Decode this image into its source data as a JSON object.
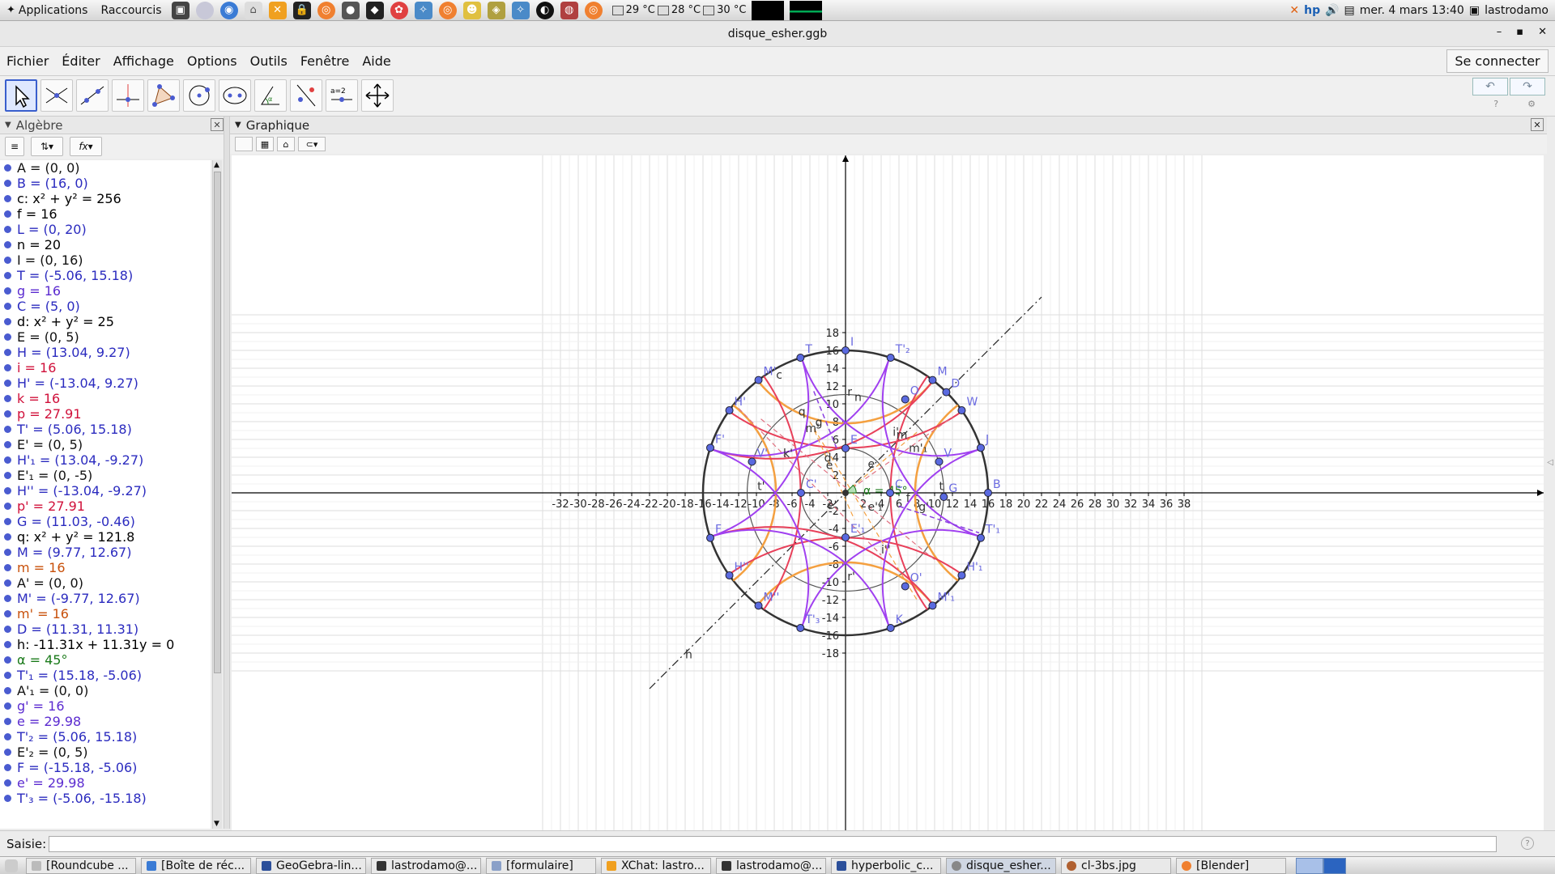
{
  "system_panel": {
    "applications": "Applications",
    "shortcuts": "Raccourcis",
    "temps": [
      "29 °C",
      "28 °C",
      "30 °C"
    ],
    "clock": "mer. 4 mars 13:40",
    "user": "lastrodamo"
  },
  "window": {
    "title": "disque_esher.ggb"
  },
  "menu": {
    "items": [
      "Fichier",
      "Éditer",
      "Affichage",
      "Options",
      "Outils",
      "Fenêtre",
      "Aide"
    ],
    "connect": "Se connecter"
  },
  "toolbar": {
    "tools": [
      "move",
      "point",
      "line",
      "perpendicular",
      "polygon",
      "circle",
      "conic",
      "angle",
      "reflect",
      "slider",
      "move-view"
    ],
    "slider_label": "a=2"
  },
  "algebra": {
    "title": "Algèbre",
    "rows": [
      {
        "text": "A = (0, 0)",
        "color": "#111111"
      },
      {
        "text": "B = (16, 0)",
        "color": "#2b2bbf"
      },
      {
        "text": "c: x² + y² = 256",
        "color": "#000000"
      },
      {
        "text": "f = 16",
        "color": "#000000"
      },
      {
        "text": "L = (0, 20)",
        "color": "#2b2bbf"
      },
      {
        "text": "n = 20",
        "color": "#000000"
      },
      {
        "text": "I = (0, 16)",
        "color": "#111111"
      },
      {
        "text": "T = (-5.06, 15.18)",
        "color": "#2b2bbf"
      },
      {
        "text": "g = 16",
        "color": "#5b2bd0"
      },
      {
        "text": "C = (5, 0)",
        "color": "#2b2bbf"
      },
      {
        "text": "d: x² + y² = 25",
        "color": "#000000"
      },
      {
        "text": "E = (0, 5)",
        "color": "#111111"
      },
      {
        "text": "H = (13.04, 9.27)",
        "color": "#2b2bbf"
      },
      {
        "text": "i = 16",
        "color": "#d0103a"
      },
      {
        "text": "H' = (-13.04, 9.27)",
        "color": "#2b2bbf"
      },
      {
        "text": "k = 16",
        "color": "#d0103a"
      },
      {
        "text": "p = 27.91",
        "color": "#d0103a"
      },
      {
        "text": "T' = (5.06, 15.18)",
        "color": "#2b2bbf"
      },
      {
        "text": "E' = (0, 5)",
        "color": "#111111"
      },
      {
        "text": "H'₁ = (13.04, -9.27)",
        "color": "#2b2bbf"
      },
      {
        "text": "E'₁ = (0, -5)",
        "color": "#111111"
      },
      {
        "text": "H'' = (-13.04, -9.27)",
        "color": "#2b2bbf"
      },
      {
        "text": "p' = 27.91",
        "color": "#d0103a"
      },
      {
        "text": "G = (11.03, -0.46)",
        "color": "#2b2bbf"
      },
      {
        "text": "q: x² + y² = 121.8",
        "color": "#000000"
      },
      {
        "text": "M = (9.77, 12.67)",
        "color": "#2b2bbf"
      },
      {
        "text": "m = 16",
        "color": "#c8500a"
      },
      {
        "text": "A' = (0, 0)",
        "color": "#111111"
      },
      {
        "text": "M' = (-9.77, 12.67)",
        "color": "#2b2bbf"
      },
      {
        "text": "m' = 16",
        "color": "#c8500a"
      },
      {
        "text": "D = (11.31, 11.31)",
        "color": "#2b2bbf"
      },
      {
        "text": "h: -11.31x + 11.31y = 0",
        "color": "#000000"
      },
      {
        "text": "α = 45°",
        "color": "#1a7a1a"
      },
      {
        "text": "T'₁ = (15.18, -5.06)",
        "color": "#2b2bbf"
      },
      {
        "text": "A'₁ = (0, 0)",
        "color": "#111111"
      },
      {
        "text": "g' = 16",
        "color": "#5b2bd0"
      },
      {
        "text": "e = 29.98",
        "color": "#5b2bd0"
      },
      {
        "text": "T'₂ = (5.06, 15.18)",
        "color": "#2b2bbf"
      },
      {
        "text": "E'₂ = (0, 5)",
        "color": "#111111"
      },
      {
        "text": "F = (-15.18, -5.06)",
        "color": "#2b2bbf"
      },
      {
        "text": "e' = 29.98",
        "color": "#5b2bd0"
      },
      {
        "text": "T'₃ = (-5.06, -15.18)",
        "color": "#2b2bbf"
      }
    ]
  },
  "graphics": {
    "title": "Graphique",
    "x_ticks": [
      -32,
      -30,
      -28,
      -26,
      -24,
      -22,
      -20,
      -18,
      -16,
      -14,
      -12,
      -10,
      -8,
      -6,
      -4,
      -2,
      2,
      4,
      6,
      8,
      10,
      12,
      14,
      16,
      18,
      20,
      22,
      24,
      26,
      28,
      30,
      32,
      34,
      36,
      38
    ],
    "y_ticks": [
      -18,
      -16,
      -14,
      -12,
      -10,
      -8,
      -6,
      -4,
      -2,
      2,
      4,
      6,
      8,
      10,
      12,
      14,
      16,
      18
    ],
    "circles": [
      {
        "name": "c",
        "r": 16,
        "color": "#333333"
      },
      {
        "name": "q",
        "r": 11.04,
        "color": "#555555"
      },
      {
        "name": "d",
        "r": 5,
        "color": "#555555"
      }
    ],
    "angle_label": "α = 45°",
    "points": [
      {
        "label": "B",
        "x": 16,
        "y": 0
      },
      {
        "label": "T",
        "x": -5.06,
        "y": 15.18
      },
      {
        "label": "T'₂",
        "x": 5.06,
        "y": 15.18
      },
      {
        "label": "H'",
        "x": -13.04,
        "y": 9.27
      },
      {
        "label": "W",
        "x": 13.04,
        "y": 9.27
      },
      {
        "label": "M",
        "x": 9.77,
        "y": 12.67
      },
      {
        "label": "M'",
        "x": -9.77,
        "y": 12.67
      },
      {
        "label": "D",
        "x": 11.31,
        "y": 11.31
      },
      {
        "label": "F",
        "x": -15.18,
        "y": -5.06
      },
      {
        "label": "F'",
        "x": -15.18,
        "y": 5.06
      },
      {
        "label": "J",
        "x": 15.18,
        "y": 5.06
      },
      {
        "label": "T'₁",
        "x": 15.18,
        "y": -5.06
      },
      {
        "label": "H''",
        "x": -13.04,
        "y": -9.27
      },
      {
        "label": "H'₁",
        "x": 13.04,
        "y": -9.27
      },
      {
        "label": "M''",
        "x": -9.77,
        "y": -12.67
      },
      {
        "label": "M'₁",
        "x": 9.77,
        "y": -12.67
      },
      {
        "label": "T'₃",
        "x": -5.06,
        "y": -15.18
      },
      {
        "label": "K",
        "x": 5.06,
        "y": -15.18
      },
      {
        "label": "G",
        "x": 11.03,
        "y": -0.46
      },
      {
        "label": "C",
        "x": 5,
        "y": 0
      },
      {
        "label": "C'",
        "x": -5,
        "y": 0
      },
      {
        "label": "E",
        "x": 0,
        "y": 5
      },
      {
        "label": "E'₁",
        "x": 0,
        "y": -5
      },
      {
        "label": "O",
        "x": 6.7,
        "y": 10.5
      },
      {
        "label": "O'",
        "x": 6.7,
        "y": -10.5
      },
      {
        "label": "V",
        "x": 10.5,
        "y": 3.5
      },
      {
        "label": "V'",
        "x": -10.5,
        "y": 3.5
      },
      {
        "label": "I",
        "x": 0,
        "y": 16
      }
    ],
    "curve_labels": [
      {
        "t": "c",
        "x": -7.8,
        "y": 12.8
      },
      {
        "t": "q",
        "x": -5.3,
        "y": 8.7
      },
      {
        "t": "d",
        "x": -2.4,
        "y": 3.5
      },
      {
        "t": "n",
        "x": 1,
        "y": 10.3
      },
      {
        "t": "r",
        "x": 0.2,
        "y": 10.9
      },
      {
        "t": "r'",
        "x": 0.2,
        "y": -9.8
      },
      {
        "t": "g",
        "x": -3.4,
        "y": 7.5
      },
      {
        "t": "m'",
        "x": -4.5,
        "y": 6.8
      },
      {
        "t": "k'",
        "x": -7,
        "y": 4
      },
      {
        "t": "t'",
        "x": -9.9,
        "y": 0.3
      },
      {
        "t": "t",
        "x": 10.5,
        "y": 0.3
      },
      {
        "t": "f",
        "x": 6.8,
        "y": -1
      },
      {
        "t": "g'",
        "x": 8.2,
        "y": -2
      },
      {
        "t": "e",
        "x": -2.2,
        "y": 2.7
      },
      {
        "t": "e'",
        "x": -2.1,
        "y": -1.8
      },
      {
        "t": "e'₁",
        "x": 2.5,
        "y": -2
      },
      {
        "t": "e",
        "x": 2.5,
        "y": 2.8
      },
      {
        "t": "i'",
        "x": 5.3,
        "y": 6.4
      },
      {
        "t": "m'₁",
        "x": 7.1,
        "y": 4.6
      },
      {
        "t": "m",
        "x": 5.7,
        "y": 6.1
      },
      {
        "t": "i''",
        "x": 4,
        "y": -6.8
      },
      {
        "t": "h",
        "x": -18,
        "y": -18.6
      }
    ]
  },
  "input": {
    "label": "Saisie:"
  },
  "taskbar": {
    "tasks": [
      "[Roundcube ...",
      "[Boîte de réc...",
      "GeoGebra-lin...",
      "lastrodamo@...",
      "[formulaire]",
      "XChat: lastro...",
      "lastrodamo@...",
      "hyperbolic_c...",
      "disque_esher...",
      "cl-3bs.jpg",
      "[Blender]"
    ]
  },
  "colors": {
    "violet": "#a040f0",
    "red": "#e8405a",
    "orange": "#f4a040",
    "blue_point": "#5a6ae0",
    "grid": "#e6e6e6"
  }
}
